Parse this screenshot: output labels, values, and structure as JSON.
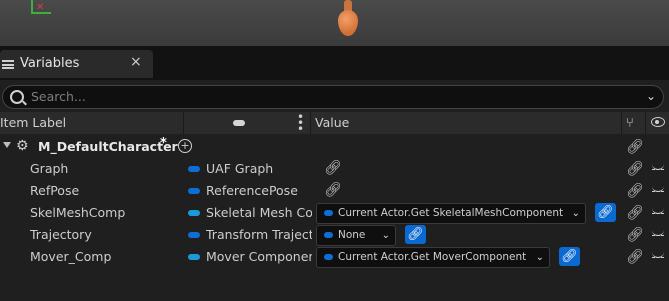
{
  "window": {
    "tab_label": "Variables"
  },
  "search": {
    "placeholder": "Search..."
  },
  "columns": {
    "item_label": "Item Label",
    "value": "Value"
  },
  "root": {
    "name": "M_DefaultCharacter",
    "modified_marker": "*"
  },
  "rows": [
    {
      "name": "Graph",
      "type": "UAF Graph",
      "pill_color": "#0d6fd6",
      "value": null
    },
    {
      "name": "RefPose",
      "type": "ReferencePose",
      "pill_color": "#0d6fd6",
      "value": null
    },
    {
      "name": "SkelMeshComp",
      "type": "Skeletal Mesh Con",
      "pill_color": "#1a9bd8",
      "value": "Current Actor.Get SkeletalMeshComponent"
    },
    {
      "name": "Trajectory",
      "type": "Transform Traject",
      "pill_color": "#0d6fd6",
      "value": "None"
    },
    {
      "name": "Mover_Comp",
      "type": "Mover Component",
      "pill_color": "#1a9bd8",
      "value": "Current Actor.Get MoverComponent"
    }
  ],
  "icons": {
    "tab": "hamburger-icon",
    "close": "close-icon",
    "search": "search-icon",
    "chevron": "chevron-down-icon",
    "root": "gear-icon",
    "link": "link-icon",
    "visibility": "eye-icon",
    "branch": "branch-icon"
  },
  "colors": {
    "accent": "#0a6ad2",
    "background": "#1f1f1f"
  }
}
